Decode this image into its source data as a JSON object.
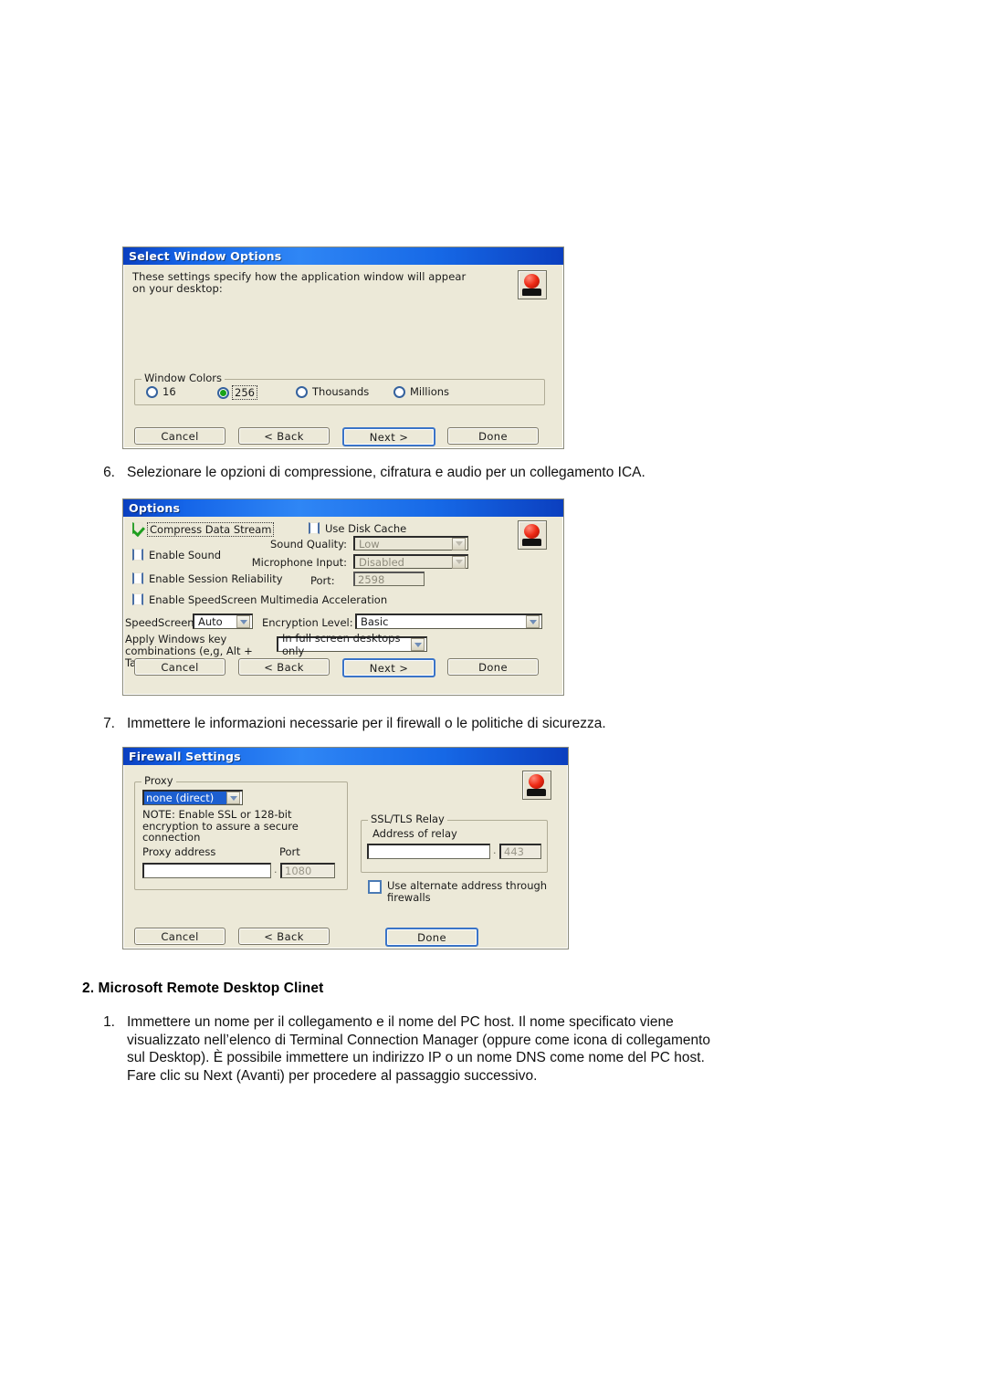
{
  "page": {
    "background": "#ffffff",
    "accent_blue": "#1565e8",
    "dialog_face": "#ece9d8"
  },
  "steps": {
    "step6": {
      "num": "6.",
      "text": "Selezionare le opzioni di compressione, cifratura e audio per un collegamento ICA."
    },
    "step7": {
      "num": "7.",
      "text": "Immettere le informazioni necessarie per il firewall o le politiche di sicurezza."
    },
    "section2_heading": "2. Microsoft Remote Desktop Clinet",
    "step1": {
      "num": "1.",
      "text": "Immettere un nome per il collegamento e il nome del PC host. Il nome specificato viene visualizzato nell’elenco di Terminal Connection Manager (oppure come icona di collegamento sul Desktop). È possibile immettere un indirizzo IP o un nome DNS come nome del PC host.\nFare clic su Next (Avanti) per procedere al passaggio successivo."
    }
  },
  "dialog_window_options": {
    "title": "Select Window Options",
    "intro": "These settings specify how the application window will appear\non your desktop:",
    "icon": "citrix-ball-icon",
    "group": {
      "label": "Window Colors"
    },
    "radios": [
      {
        "label": "16",
        "selected": false
      },
      {
        "label": "256",
        "selected": true,
        "focused": true
      },
      {
        "label": "Thousands",
        "selected": false
      },
      {
        "label": "Millions",
        "selected": false
      }
    ],
    "buttons": [
      {
        "name": "cancel",
        "label": "Cancel",
        "focused": false
      },
      {
        "name": "back",
        "label": "< Back",
        "focused": false,
        "accel": "B"
      },
      {
        "name": "next",
        "label": "Next >",
        "focused": true,
        "accel": "N"
      },
      {
        "name": "done",
        "label": "Done",
        "focused": false
      }
    ]
  },
  "dialog_options": {
    "title": "Options",
    "icon": "citrix-ball-icon",
    "checkboxes": [
      {
        "name": "compress-data-stream",
        "label": "Compress Data Stream",
        "checked": true,
        "focused": true
      },
      {
        "name": "use-disk-cache",
        "label": "Use Disk Cache",
        "checked": false
      },
      {
        "name": "enable-sound",
        "label": "Enable Sound",
        "checked": false
      },
      {
        "name": "enable-session-reliability",
        "label": "Enable Session Reliability",
        "checked": false
      },
      {
        "name": "enable-speedscreen-multimedia",
        "label": "Enable SpeedScreen Multimedia Acceleration",
        "checked": false
      }
    ],
    "fields": {
      "sound_quality_label": "Sound Quality:",
      "sound_quality_value": "Low",
      "microphone_label": "Microphone Input:",
      "microphone_value": "Disabled",
      "port_label": "Port:",
      "port_value": "2598",
      "speedscreen_label": "SpeedScreen:",
      "speedscreen_value": "Auto",
      "encryption_label": "Encryption Level:",
      "encryption_value": "Basic",
      "winkey_label": "Apply Windows key\ncombinations (e,g, Alt + Tab):",
      "winkey_value": "In full screen desktops only"
    },
    "buttons": [
      {
        "name": "cancel",
        "label": "Cancel",
        "focused": false
      },
      {
        "name": "back",
        "label": "< Back",
        "focused": false,
        "accel": "B"
      },
      {
        "name": "next",
        "label": "Next >",
        "focused": true,
        "accel": "N"
      },
      {
        "name": "done",
        "label": "Done",
        "focused": false
      }
    ]
  },
  "dialog_firewall": {
    "title": "Firewall Settings",
    "icon": "citrix-ball-icon",
    "proxy_group_label": "Proxy",
    "proxy_value": "none (direct)",
    "proxy_note": "NOTE: Enable SSL or 128-bit\nencryption to assure a secure\nconnection",
    "proxy_address_label": "Proxy address",
    "proxy_address_value": "",
    "port_label": "Port",
    "port_value": "1080",
    "relay_group_label": "SSL/TLS Relay",
    "relay_address_label": "Address of relay",
    "relay_address_value": "",
    "relay_port_value": "443",
    "alt_address_checkbox": "Use alternate address through\nfirewalls",
    "alt_address_checked": false,
    "buttons": [
      {
        "name": "cancel",
        "label": "Cancel",
        "focused": false
      },
      {
        "name": "back",
        "label": "< Back",
        "focused": false,
        "accel": "B"
      },
      {
        "name": "done",
        "label": "Done",
        "focused": true
      }
    ]
  }
}
